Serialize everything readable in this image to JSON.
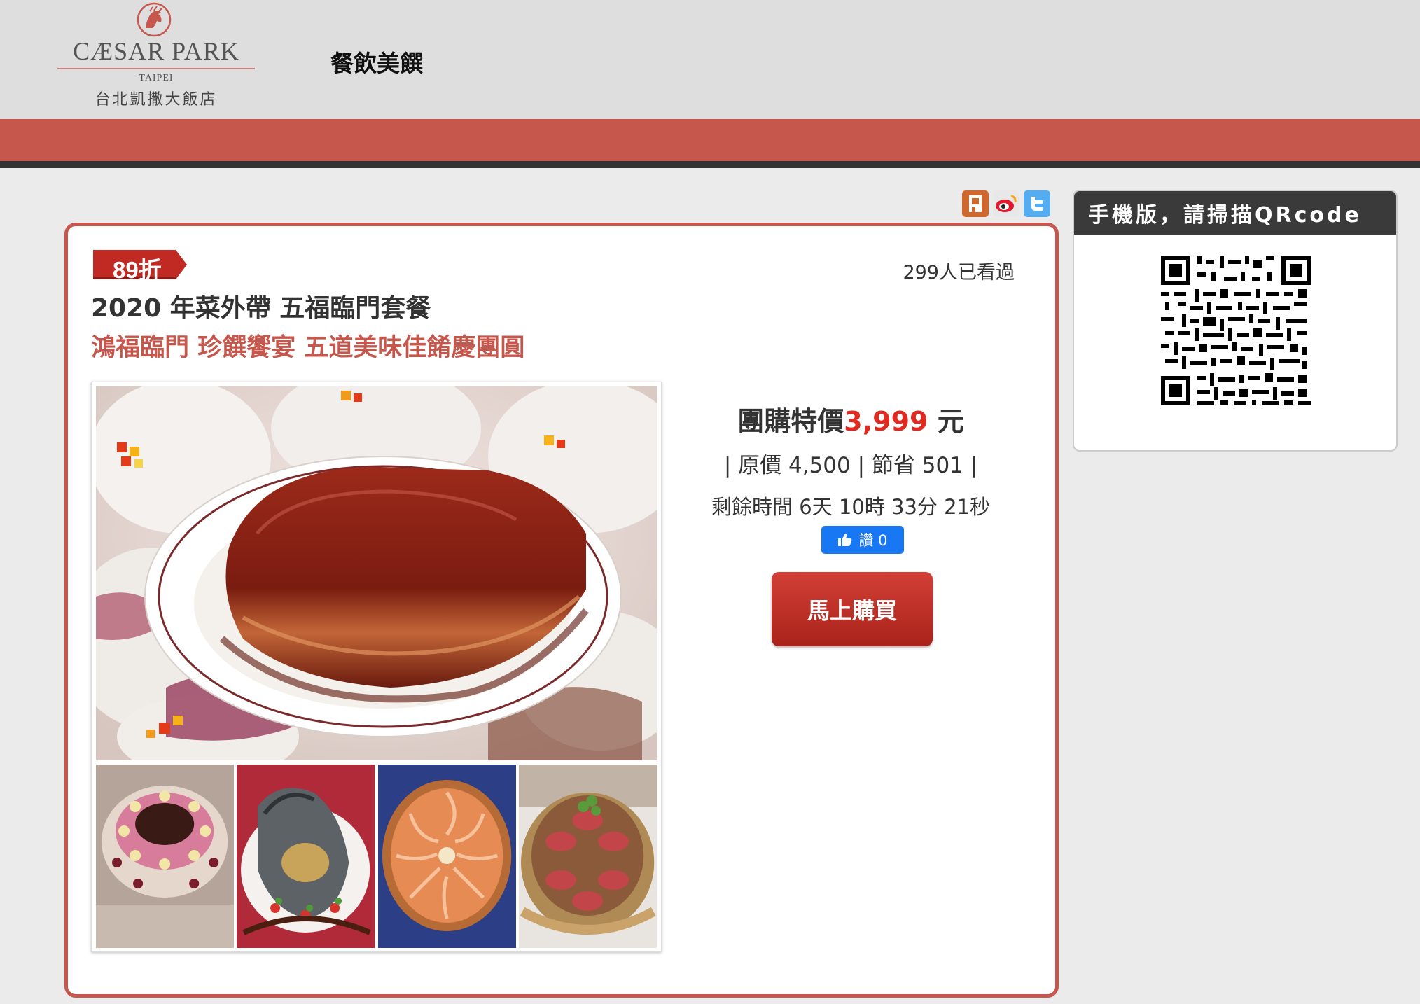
{
  "header": {
    "logo_name": "CÆSAR PARK",
    "logo_city": "TAIPEI",
    "logo_chinese": "台北凱撒大飯店",
    "nav_title": "餐飲美饌"
  },
  "share": {
    "icons": [
      "plurk-icon",
      "weibo-icon",
      "twitter-icon"
    ]
  },
  "deal": {
    "discount_badge": "89折",
    "views": "299人已看過",
    "title": "2020 年菜外帶 五福臨門套餐",
    "subtitle": "鴻福臨門 珍饌饗宴 五道美味佳餚慶團圓",
    "price_label": "團購特價",
    "price_value": "3,999",
    "price_unit": " 元",
    "original_line": "| 原價 4,500 | 節省 501 |",
    "remaining": "剩餘時間 6天 10時 33分 21秒",
    "like_label": "讚 0",
    "buy_label": "馬上購買"
  },
  "qr": {
    "heading": "手機版，請掃描QRcode"
  },
  "colors": {
    "brand_red": "#c5574c",
    "price_red": "#e02a1f",
    "facebook_blue": "#1877f2"
  }
}
